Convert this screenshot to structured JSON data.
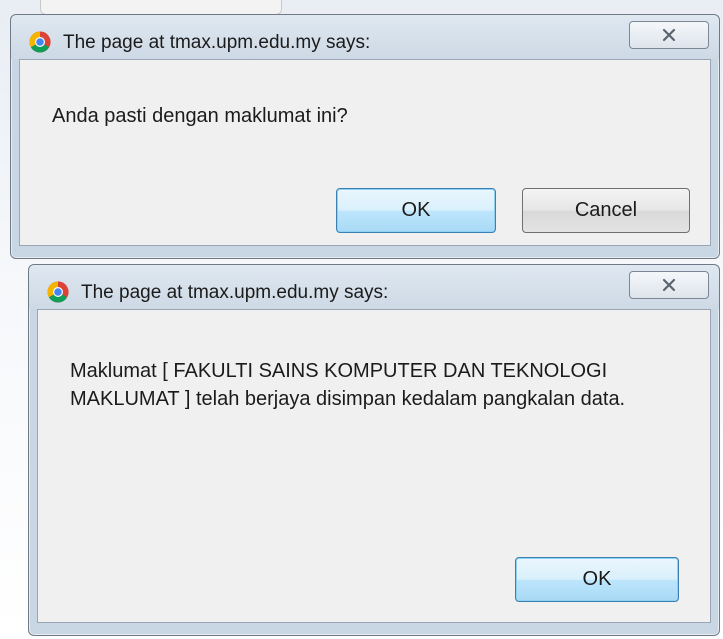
{
  "dialogs": [
    {
      "title": "The page at tmax.upm.edu.my says:",
      "message": "Anda pasti dengan maklumat ini?",
      "buttons": {
        "ok": "OK",
        "cancel": "Cancel"
      }
    },
    {
      "title": "The page at tmax.upm.edu.my says:",
      "message": "Maklumat  [ FAKULTI SAINS KOMPUTER DAN TEKNOLOGI MAKLUMAT ] telah berjaya disimpan kedalam pangkalan data.",
      "buttons": {
        "ok": "OK"
      }
    }
  ],
  "icons": {
    "app": "chrome-icon",
    "close": "close-icon"
  },
  "colors": {
    "titlebar": "#cdd9e5",
    "panel": "#f0f0f0",
    "default_button_border": "#3c7fb1"
  }
}
